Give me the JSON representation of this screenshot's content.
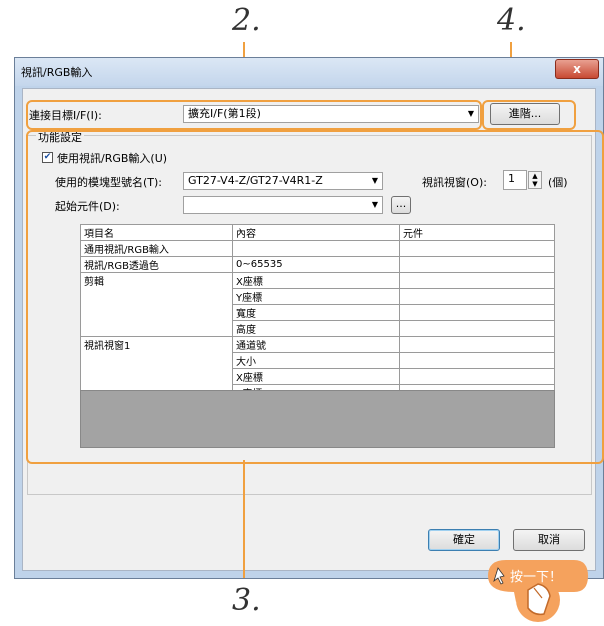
{
  "annotations": {
    "step2": "2.",
    "step3": "3.",
    "step4": "4.",
    "click_hint": "按一下！"
  },
  "window": {
    "title": "視訊/RGB輸入",
    "close_glyph": "x"
  },
  "connection": {
    "label": "連接目標I/F(I):",
    "value": "擴充I/F(第1段)",
    "advanced_button": "進階..."
  },
  "function_settings": {
    "title": "功能設定",
    "use_checkbox_label": "使用視訊/RGB輸入(U)",
    "use_checked": true,
    "model_label": "使用的模塊型號名(T):",
    "model_value": "GT27-V4-Z/GT27-V4R1-Z",
    "window_count_label": "視訊視窗(O):",
    "window_count_value": "1",
    "window_count_unit": "(個)",
    "start_device_label": "起始元件(D):",
    "start_device_value": "",
    "browse_button": "..."
  },
  "table": {
    "headers": [
      "項目名",
      "內容",
      "元件"
    ],
    "rows": [
      [
        "通用視訊/RGB輸入",
        "",
        ""
      ],
      [
        "視訊/RGB透過色",
        "0~65535",
        ""
      ],
      [
        "剪輯",
        "X座標",
        ""
      ],
      [
        "",
        "Y座標",
        ""
      ],
      [
        "",
        "寬度",
        ""
      ],
      [
        "",
        "高度",
        ""
      ],
      [
        "視訊視窗1",
        "通道號",
        ""
      ],
      [
        "",
        "大小",
        ""
      ],
      [
        "",
        "X座標",
        ""
      ],
      [
        "",
        "Y座標",
        ""
      ]
    ]
  },
  "footer": {
    "ok_button": "確定",
    "cancel_button": "取消"
  },
  "colors": {
    "callout": "#f0a040",
    "window_frame": "#bfd3ea",
    "close": "#c74a33"
  }
}
